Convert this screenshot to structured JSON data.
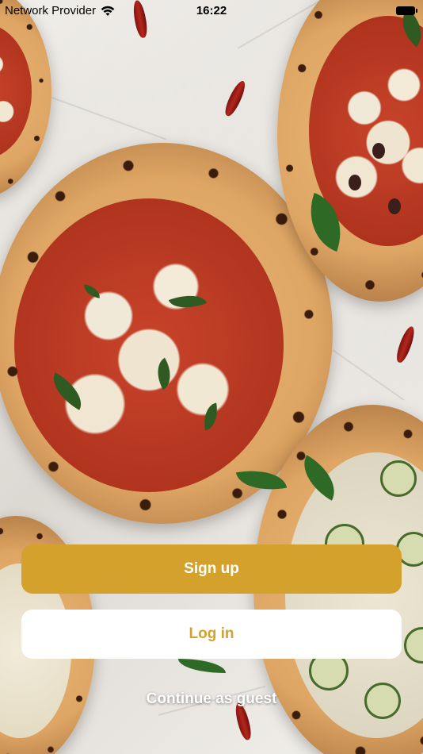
{
  "status_bar": {
    "carrier": "Network Provider",
    "time": "16:22",
    "wifi_icon": "wifi-icon",
    "battery_icon": "battery-icon"
  },
  "background": {
    "description_icon": "pizza-background-image"
  },
  "actions": {
    "signup_label": "Sign up",
    "login_label": "Log in",
    "guest_label": "Continue as guest"
  },
  "colors": {
    "accent": "#d4a12c",
    "button_light": "#ffffff",
    "text_on_accent": "#ffffff"
  }
}
